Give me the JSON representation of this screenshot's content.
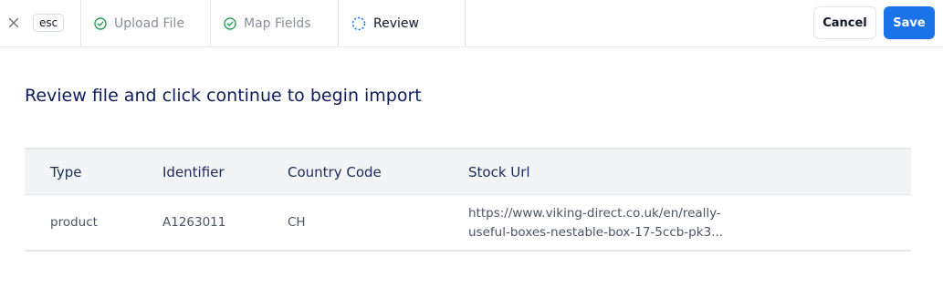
{
  "topbar": {
    "esc_label": "esc",
    "steps": [
      {
        "label": "Upload File",
        "status": "done",
        "icon": "check-circle-icon"
      },
      {
        "label": "Map Fields",
        "status": "done",
        "icon": "check-circle-icon"
      },
      {
        "label": "Review",
        "status": "active",
        "icon": "dashed-circle-icon"
      }
    ],
    "cancel_label": "Cancel",
    "save_label": "Save"
  },
  "main": {
    "heading": "Review file and click continue to begin import",
    "table": {
      "columns": [
        "Type",
        "Identifier",
        "Country Code",
        "Stock Url"
      ],
      "rows": [
        {
          "type": "product",
          "identifier": "A1263011",
          "country_code": "CH",
          "stock_url_line1": "https://www.viking-direct.co.uk/en/really-",
          "stock_url_line2": "useful-boxes-nestable-box-17-5ccb-pk3..."
        }
      ]
    }
  },
  "colors": {
    "accent": "#1a73e8",
    "done_check": "#2e9e55",
    "active_ring": "#1a73e8",
    "heading": "#0e1d5c"
  }
}
